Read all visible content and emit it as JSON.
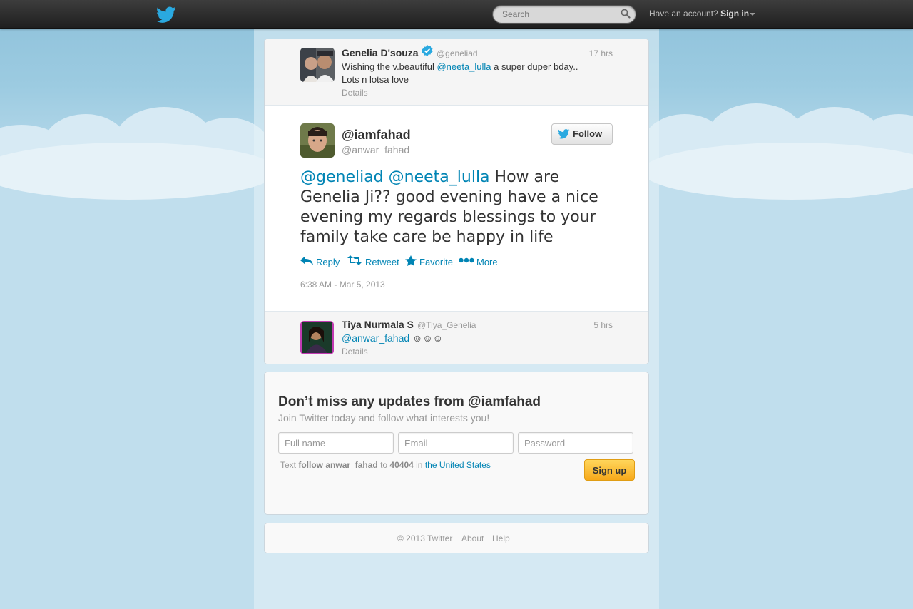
{
  "topbar": {
    "search_placeholder": "Search",
    "account_prompt": "Have an account?",
    "sign_in_label": "Sign in"
  },
  "context_before": {
    "name": "Genelia D'souza",
    "handle": "@geneliad",
    "time": "17 hrs",
    "text_pre": "Wishing the v.beautiful ",
    "mention": "@neeta_lulla",
    "text_post": " a super duper bday..",
    "text_line2": "Lots n lotsa love",
    "details": "Details"
  },
  "main_tweet": {
    "display_name": "@iamfahad",
    "handle": "@anwar_fahad",
    "follow_label": "Follow",
    "mention1": "@geneliad",
    "mention2": "@neeta_lulla",
    "text": " How are Genelia Ji?? good evening have a nice evening my regards blessings to your family take care be happy in life",
    "actions": {
      "reply": "Reply",
      "retweet": "Retweet",
      "favorite": "Favorite",
      "more": "More"
    },
    "timestamp": "6:38 AM - Mar 5, 2013"
  },
  "context_after": {
    "name": "Tiya Nurmala S",
    "handle": "@Tiya_Genelia",
    "time": "5 hrs",
    "mention": "@anwar_fahad",
    "text": " ☺☺☺",
    "details": "Details"
  },
  "signup": {
    "title": "Don’t miss any updates from @iamfahad",
    "subtitle": "Join Twitter today and follow what interests you!",
    "full_name_placeholder": "Full name",
    "email_placeholder": "Email",
    "password_placeholder": "Password",
    "sms_text": "Text",
    "sms_command": "follow anwar_fahad",
    "sms_to": "to",
    "sms_number": "40404",
    "sms_in": "in",
    "sms_country": "the United States",
    "button_label": "Sign up"
  },
  "footer": {
    "copyright": "© 2013 Twitter",
    "about": "About",
    "help": "Help"
  },
  "colors": {
    "link": "#0084b4",
    "twitter_blue": "#2aa9e0",
    "signup_orange": "#f7a91b"
  }
}
